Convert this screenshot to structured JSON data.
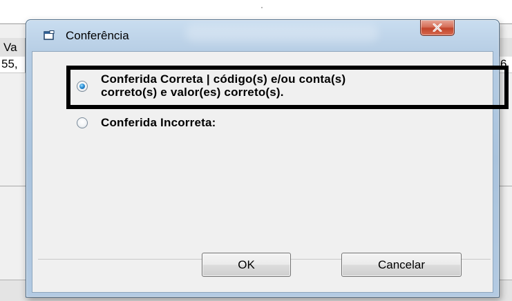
{
  "background_window": {
    "header_left_text": "Va",
    "row_left_text": "55,",
    "row_right_text": "6"
  },
  "dialog": {
    "title": "Conferência",
    "icon": "window-app-icon",
    "close_icon": "close-icon",
    "options": [
      {
        "line1": "Conferida Correta | código(s) e/ou conta(s)",
        "line2": "correto(s) e valor(es) correto(s).",
        "selected": true
      },
      {
        "line1": "Conferida Incorreta:",
        "selected": false
      }
    ],
    "buttons": {
      "ok": "OK",
      "cancel": "Cancelar"
    }
  },
  "colors": {
    "title_bar": "#b6cde4",
    "close_button": "#c2452b",
    "highlight_border": "#000000",
    "radio_selected": "#2a8fd6"
  }
}
